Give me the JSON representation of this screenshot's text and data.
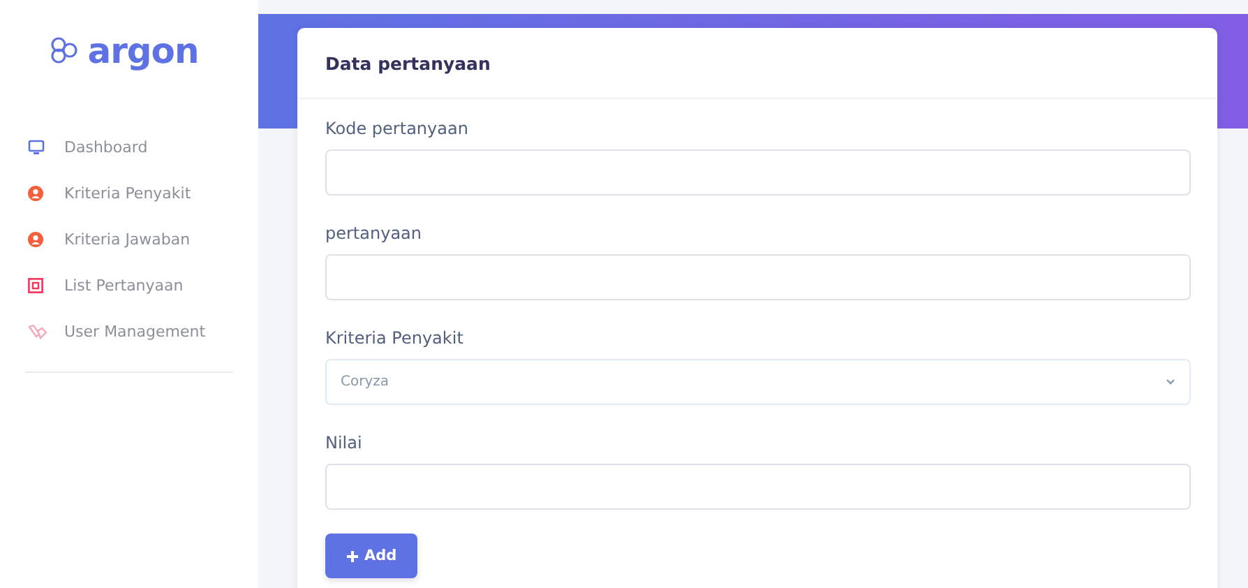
{
  "brand": {
    "name": "argon"
  },
  "sidebar": {
    "items": [
      {
        "label": "Dashboard",
        "color": "#5e72e4"
      },
      {
        "label": "Kriteria Penyakit",
        "color": "#f5603c"
      },
      {
        "label": "Kriteria Jawaban",
        "color": "#f5603c"
      },
      {
        "label": "List Pertanyaan",
        "color": "#f5365c"
      },
      {
        "label": "User Management",
        "color": "#f3a4b5"
      }
    ]
  },
  "card": {
    "title": "Data pertanyaan",
    "fields": [
      {
        "kind": "input",
        "label": "Kode pertanyaan"
      },
      {
        "kind": "input",
        "label": "pertanyaan"
      },
      {
        "kind": "select",
        "label": "Kriteria Penyakit",
        "value": "Coryza"
      },
      {
        "kind": "input",
        "label": "Nilai"
      }
    ],
    "button": "Add"
  }
}
